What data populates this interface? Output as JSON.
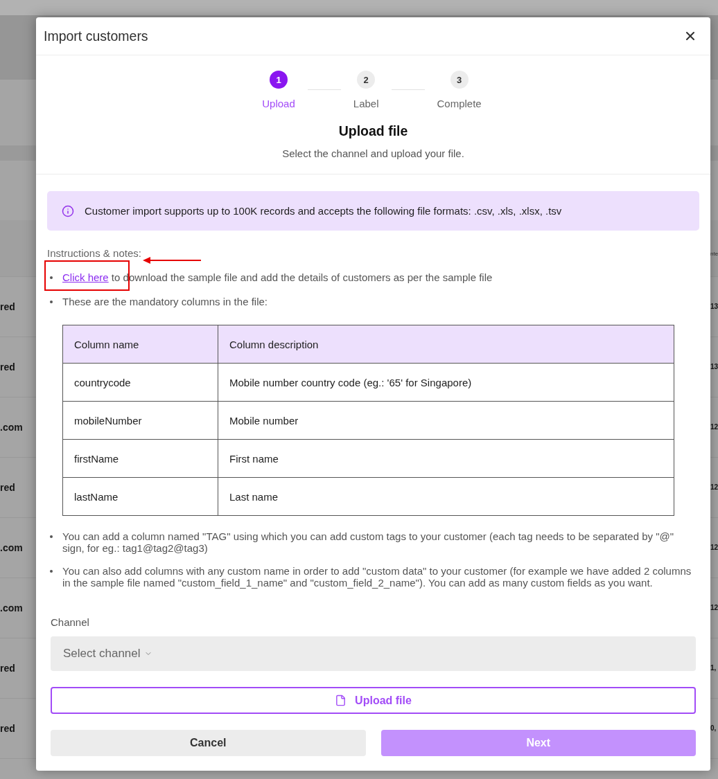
{
  "background_page": {
    "table_header": "nte",
    "rows": [
      {
        "column_1": "red",
        "column_2": "13"
      },
      {
        "column_1": "red",
        "column_2": "13"
      },
      {
        "column_1": ".com",
        "column_2": "12"
      },
      {
        "column_1": "red",
        "column_2": "12"
      },
      {
        "column_1": ".com",
        "column_2": "12"
      },
      {
        "column_1": ".com",
        "column_2": "12"
      },
      {
        "column_1": "red",
        "column_2": "1,"
      },
      {
        "column_1": "red",
        "column_2": "0,"
      }
    ]
  },
  "dialog": {
    "title": "Import customers",
    "steps": [
      {
        "number": "1",
        "label": "Upload",
        "selected": true
      },
      {
        "number": "2",
        "label": "Label",
        "selected": false
      },
      {
        "number": "3",
        "label": "Complete",
        "selected": false
      }
    ],
    "heading": "Upload file",
    "subheading": "Select the channel and upload your file.",
    "info_banner": "Customer import supports up to 100K records and accepts the following file formats: .csv, .xls, .xlsx, .tsv",
    "instructions_label": {
      "text": "Instructions & notes:",
      "arrow": true
    },
    "instructions": [
      {
        "kind": "link",
        "link": "Click here",
        "text": "to download the sample file and add the details of customers as per the sample file",
        "framed": true
      },
      {
        "kind": "text",
        "text": "These are the mandatory columns in the file:",
        "framed": false
      }
    ],
    "table": {
      "columns": [
        "Column name",
        "Column description"
      ],
      "rows": [
        [
          "countrycode",
          "Mobile number country code (eg.: '65' for Singapore)"
        ],
        [
          "mobileNumber",
          "Mobile number"
        ],
        [
          "firstName",
          "First name"
        ],
        [
          "lastName",
          "Last name"
        ]
      ]
    },
    "notes": [
      "You can add a column named \"TAG\" using which you can add custom tags to your customer (each tag needs to be separated by \"@\" sign, for eg.: tag1@tag2@tag3)",
      "You can also add columns with any custom name in order to add \"custom data\" to your customer (for example we have added 2 columns in the sample file named \"custom_field_1_name\" and \"custom_field_2_name\"). You can add as many custom fields as you want."
    ],
    "channel": {
      "label": "Channel",
      "placeholder": "Select channel"
    },
    "upload_button": {
      "label": "Upload file"
    },
    "buttons": [
      {
        "label": "Cancel",
        "kind": "secondary",
        "disabled": false
      },
      {
        "label": "Next",
        "kind": "primary",
        "disabled": true
      }
    ]
  }
}
